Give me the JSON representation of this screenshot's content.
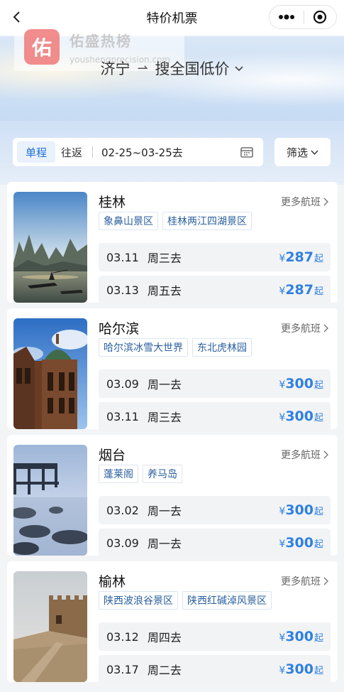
{
  "nav": {
    "title": "特价机票"
  },
  "watermark": {
    "logo_char": "佑",
    "name": "佑盛热榜",
    "url": "youshengprecision.com"
  },
  "route": {
    "from": "济宁",
    "arrow": "⇀",
    "to": "搜全国低价"
  },
  "trip": {
    "oneway_label": "单程",
    "round_label": "往返",
    "date_range": "02-25~03-25去",
    "filter_label": "筛选"
  },
  "colors": {
    "accent": "#2f80e0",
    "tag_text": "#2a5f9e"
  },
  "destinations": [
    {
      "city": "桂林",
      "more_label": "更多航班",
      "tags": [
        "象鼻山景区",
        "桂林两江四湖景区"
      ],
      "flights": [
        {
          "date": "03.11",
          "dow": "周三去",
          "currency": "¥",
          "price": "287",
          "suffix": "起"
        },
        {
          "date": "03.13",
          "dow": "周五去",
          "currency": "¥",
          "price": "287",
          "suffix": "起"
        }
      ]
    },
    {
      "city": "哈尔滨",
      "more_label": "更多航班",
      "tags": [
        "哈尔滨冰雪大世界",
        "东北虎林园"
      ],
      "flights": [
        {
          "date": "03.09",
          "dow": "周一去",
          "currency": "¥",
          "price": "300",
          "suffix": "起"
        },
        {
          "date": "03.11",
          "dow": "周三去",
          "currency": "¥",
          "price": "300",
          "suffix": "起"
        }
      ]
    },
    {
      "city": "烟台",
      "more_label": "更多航班",
      "tags": [
        "蓬莱阁",
        "养马岛"
      ],
      "flights": [
        {
          "date": "03.02",
          "dow": "周一去",
          "currency": "¥",
          "price": "300",
          "suffix": "起"
        },
        {
          "date": "03.09",
          "dow": "周一去",
          "currency": "¥",
          "price": "300",
          "suffix": "起"
        }
      ]
    },
    {
      "city": "榆林",
      "more_label": "更多航班",
      "tags": [
        "陕西波浪谷景区",
        "陕西红碱淖风景区"
      ],
      "flights": [
        {
          "date": "03.12",
          "dow": "周四去",
          "currency": "¥",
          "price": "300",
          "suffix": "起"
        },
        {
          "date": "03.17",
          "dow": "周二去",
          "currency": "¥",
          "price": "300",
          "suffix": "起"
        }
      ]
    }
  ]
}
